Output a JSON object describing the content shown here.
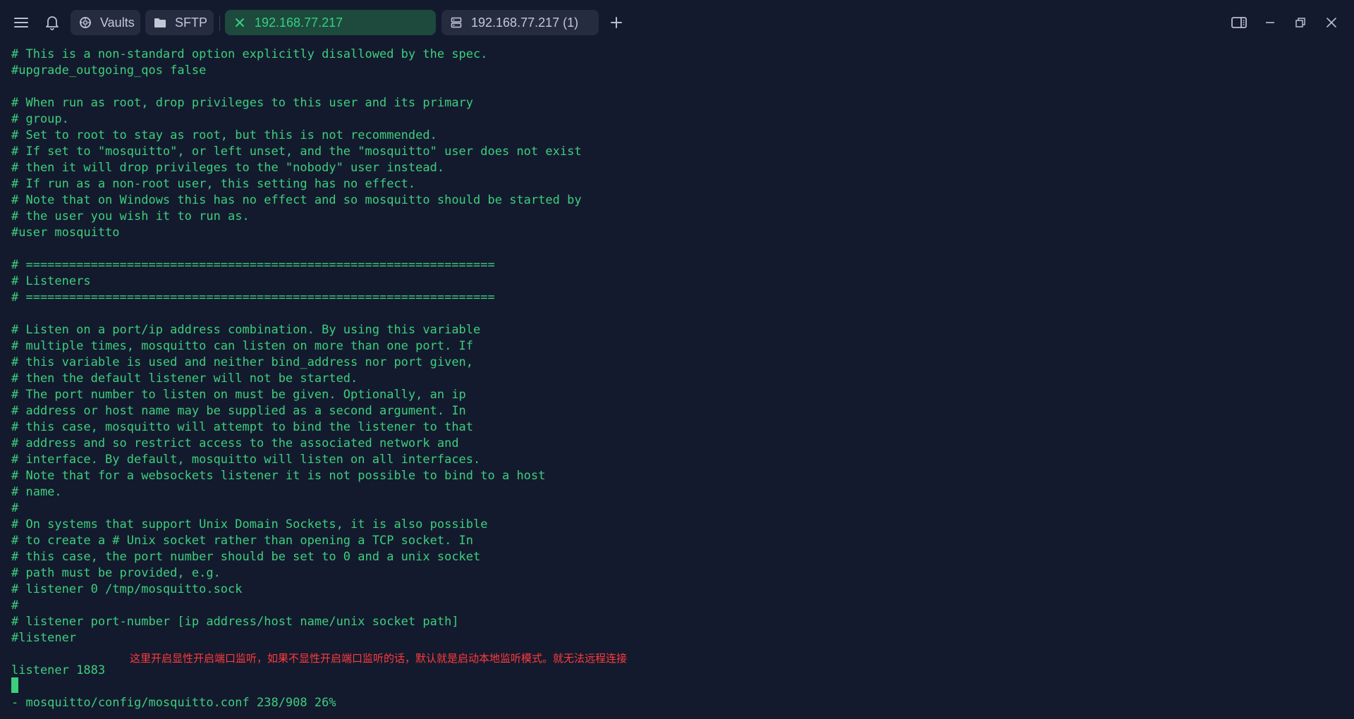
{
  "tabs": {
    "vaults": "Vaults",
    "sftp": "SFTP",
    "active_host": "192.168.77.217",
    "second_host": "192.168.77.217 (1)"
  },
  "terminal": {
    "lines": [
      "# This is a non-standard option explicitly disallowed by the spec.",
      "#upgrade_outgoing_qos false",
      "",
      "# When run as root, drop privileges to this user and its primary",
      "# group.",
      "# Set to root to stay as root, but this is not recommended.",
      "# If set to \"mosquitto\", or left unset, and the \"mosquitto\" user does not exist",
      "# then it will drop privileges to the \"nobody\" user instead.",
      "# If run as a non-root user, this setting has no effect.",
      "# Note that on Windows this has no effect and so mosquitto should be started by",
      "# the user you wish it to run as.",
      "#user mosquitto",
      "",
      "# =================================================================",
      "# Listeners",
      "# =================================================================",
      "",
      "# Listen on a port/ip address combination. By using this variable",
      "# multiple times, mosquitto can listen on more than one port. If",
      "# this variable is used and neither bind_address nor port given,",
      "# then the default listener will not be started.",
      "# The port number to listen on must be given. Optionally, an ip",
      "# address or host name may be supplied as a second argument. In",
      "# this case, mosquitto will attempt to bind the listener to that",
      "# address and so restrict access to the associated network and",
      "# interface. By default, mosquitto will listen on all interfaces.",
      "# Note that for a websockets listener it is not possible to bind to a host",
      "# name.",
      "#",
      "# On systems that support Unix Domain Sockets, it is also possible",
      "# to create a # Unix socket rather than opening a TCP socket. In",
      "# this case, the port number should be set to 0 and a unix socket",
      "# path must be provided, e.g.",
      "# listener 0 /tmp/mosquitto.sock",
      "#",
      "# listener port-number [ip address/host name/unix socket path]",
      "#listener",
      "",
      "listener 1883",
      "",
      "- mosquitto/config/mosquitto.conf 238/908 26%"
    ],
    "annotation": "这里开启显性开启端口监听，如果不显性开启端口监听的话，默认就是启动本地监听模式。就无法远程连接"
  },
  "colors": {
    "background": "#141a2e",
    "terminal_text": "#3ccf7c",
    "active_tab_bg": "#1d4a3d",
    "active_tab_text": "#35d07f",
    "annotation": "#ff3b3b"
  }
}
